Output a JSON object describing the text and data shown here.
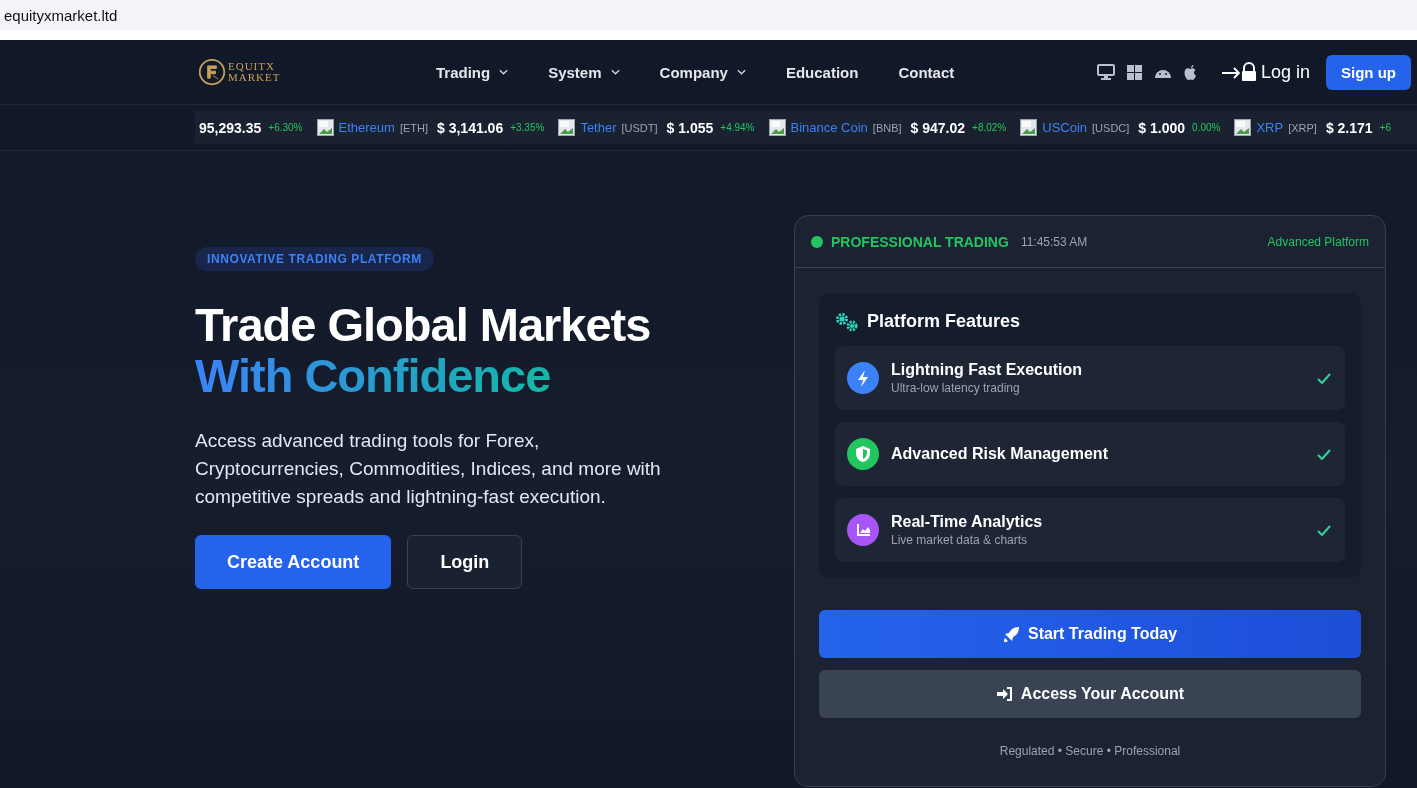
{
  "browser": {
    "url": "equityxmarket.ltd"
  },
  "logo": {
    "line1": "EQUITX",
    "line2": "MARKET"
  },
  "nav": [
    {
      "label": "Trading",
      "has_menu": true
    },
    {
      "label": "System",
      "has_menu": true
    },
    {
      "label": "Company",
      "has_menu": true
    },
    {
      "label": "Education",
      "has_menu": false
    },
    {
      "label": "Contact",
      "has_menu": false
    }
  ],
  "login": "Log in",
  "signup": "Sign up",
  "ticker": [
    {
      "price": "95,293.35",
      "change": "+6.30%"
    },
    {
      "name": "Ethereum",
      "symbol": "[ETH]",
      "price": "$ 3,141.06",
      "change": "+3.35%"
    },
    {
      "name": "Tether",
      "symbol": "[USDT]",
      "price": "$ 1.055",
      "change": "+4.94%"
    },
    {
      "name": "Binance Coin",
      "symbol": "[BNB]",
      "price": "$ 947.02",
      "change": "+8.02%"
    },
    {
      "name": "USCoin",
      "symbol": "[USDC]",
      "price": "$ 1.000",
      "change": "0.00%"
    },
    {
      "name": "XRP",
      "symbol": "[XRP]",
      "price": "$ 2.171",
      "change": "+6"
    }
  ],
  "hero": {
    "badge": "INNOVATIVE TRADING PLATFORM",
    "title_line1": "Trade Global Markets",
    "title_line2": "With Confidence",
    "text": "Access advanced trading tools for Forex, Cryptocurrencies, Commodities, Indices, and more with competitive spreads and lightning-fast execution.",
    "buttons": [
      {
        "label": "Create Account",
        "kind": "primary"
      },
      {
        "label": "Login",
        "kind": "outline"
      }
    ]
  },
  "card": {
    "status": "PROFESSIONAL TRADING",
    "time": "11:45:53 AM",
    "tag": "Advanced Platform",
    "features_title": "Platform Features",
    "features": [
      {
        "kind": "bolt",
        "color": "#3b82f6",
        "title": "Lightning Fast Execution",
        "subtitle": "Ultra-low latency trading",
        "checked": true
      },
      {
        "kind": "shield",
        "color": "#22c55e",
        "title": "Advanced Risk Management",
        "checked": true
      },
      {
        "kind": "chart",
        "color": "#a855f7",
        "title": "Real-Time Analytics",
        "subtitle": "Live market data & charts",
        "checked": true
      }
    ],
    "buttons": [
      {
        "label": "Start Trading Today",
        "kind": "primary"
      },
      {
        "label": "Access Your Account",
        "kind": "secondary"
      }
    ],
    "footer": "Regulated • Secure • Professional"
  }
}
